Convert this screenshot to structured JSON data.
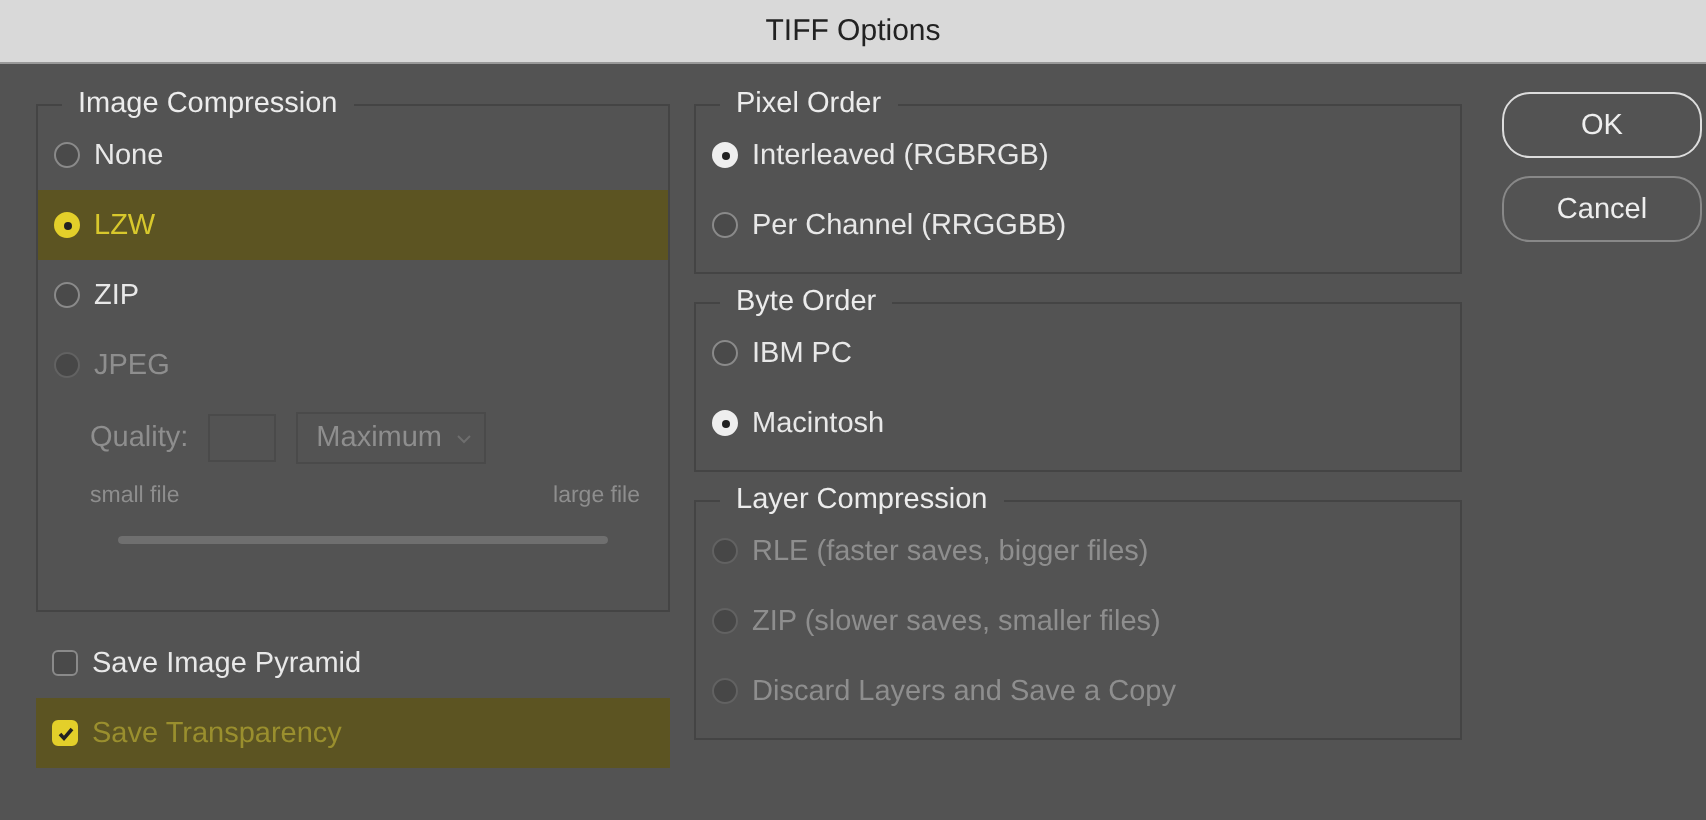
{
  "window": {
    "title": "TIFF Options"
  },
  "image_compression": {
    "title": "Image Compression",
    "options": [
      {
        "label": "None",
        "selected": false,
        "disabled": false,
        "highlighted": false
      },
      {
        "label": "LZW",
        "selected": true,
        "disabled": false,
        "highlighted": true
      },
      {
        "label": "ZIP",
        "selected": false,
        "disabled": false,
        "highlighted": false
      },
      {
        "label": "JPEG",
        "selected": false,
        "disabled": true,
        "highlighted": false
      }
    ],
    "quality": {
      "label": "Quality:",
      "preset": "Maximum",
      "disabled": true,
      "small_label": "small file",
      "large_label": "large file",
      "level": 1
    }
  },
  "save_options": [
    {
      "label": "Save Image Pyramid",
      "checked": false,
      "highlighted": false
    },
    {
      "label": "Save Transparency",
      "checked": true,
      "highlighted": true
    }
  ],
  "pixel_order": {
    "title": "Pixel Order",
    "options": [
      {
        "label": "Interleaved (RGBRGB)",
        "selected": true,
        "disabled": false
      },
      {
        "label": "Per Channel (RRGGBB)",
        "selected": false,
        "disabled": false
      }
    ]
  },
  "byte_order": {
    "title": "Byte Order",
    "options": [
      {
        "label": "IBM PC",
        "selected": false,
        "disabled": false
      },
      {
        "label": "Macintosh",
        "selected": true,
        "disabled": false
      }
    ]
  },
  "layer_compression": {
    "title": "Layer Compression",
    "options": [
      {
        "label": "RLE (faster saves, bigger files)",
        "selected": false,
        "disabled": true
      },
      {
        "label": "ZIP (slower saves, smaller files)",
        "selected": false,
        "disabled": true
      },
      {
        "label": "Discard Layers and Save a Copy",
        "selected": false,
        "disabled": true
      }
    ]
  },
  "buttons": [
    {
      "label": "OK",
      "default": true
    },
    {
      "label": "Cancel",
      "default": false
    }
  ]
}
